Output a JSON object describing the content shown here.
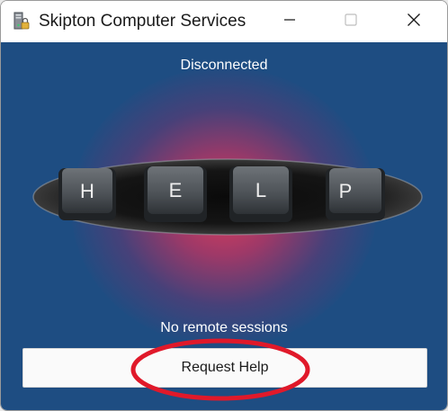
{
  "window": {
    "title": "Skipton Computer Services",
    "app_icon": "computer-lock-icon",
    "controls": {
      "minimize_icon": "minimize-icon",
      "maximize_icon": "maximize-icon",
      "close_icon": "close-icon"
    }
  },
  "main": {
    "connection_status": "Disconnected",
    "banner_keys": [
      "H",
      "E",
      "L",
      "P"
    ],
    "sessions_status": "No remote sessions",
    "request_button_label": "Request Help"
  },
  "colors": {
    "background": "#1e4d82",
    "glow": "#e63c5a",
    "highlight_ring": "#e0192a",
    "button_bg": "#fafafa"
  }
}
